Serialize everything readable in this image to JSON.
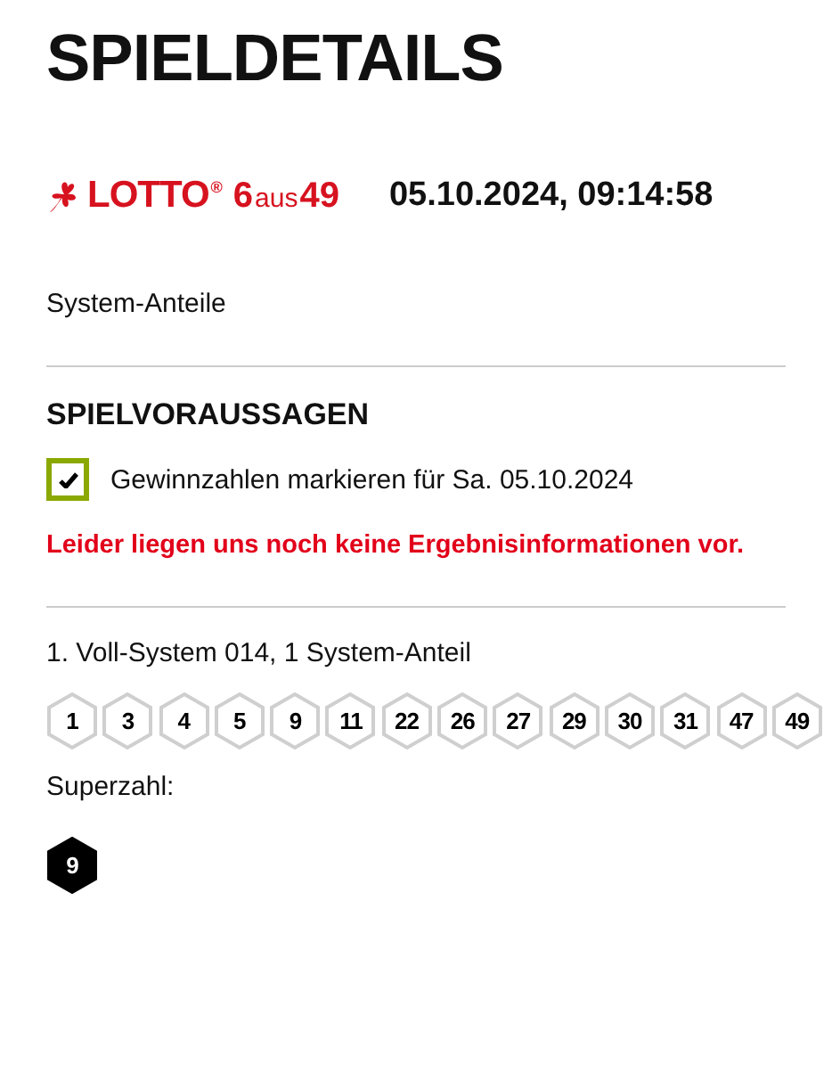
{
  "title": "SPIELDETAILS",
  "game": {
    "logo": {
      "name": "LOTTO",
      "mark": "®",
      "six": "6",
      "aus": "aus",
      "fortynine": "49"
    },
    "datetime": "05.10.2024, 09:14:58"
  },
  "system_label": "System-Anteile",
  "predictions": {
    "heading": "SPIELVORAUSSAGEN",
    "checkbox": {
      "label": "Gewinnzahlen markieren für Sa. 05.10.2024",
      "checked": true
    },
    "notice": "Leider liegen uns noch keine Ergebnisinformationen vor."
  },
  "ticket": {
    "label": "1. Voll-System 014, 1 System-Anteil",
    "numbers": [
      "1",
      "3",
      "4",
      "5",
      "9",
      "11",
      "22",
      "26",
      "27",
      "29",
      "30",
      "31",
      "47",
      "49"
    ],
    "superzahl_label": "Superzahl:",
    "superzahl": "9"
  }
}
